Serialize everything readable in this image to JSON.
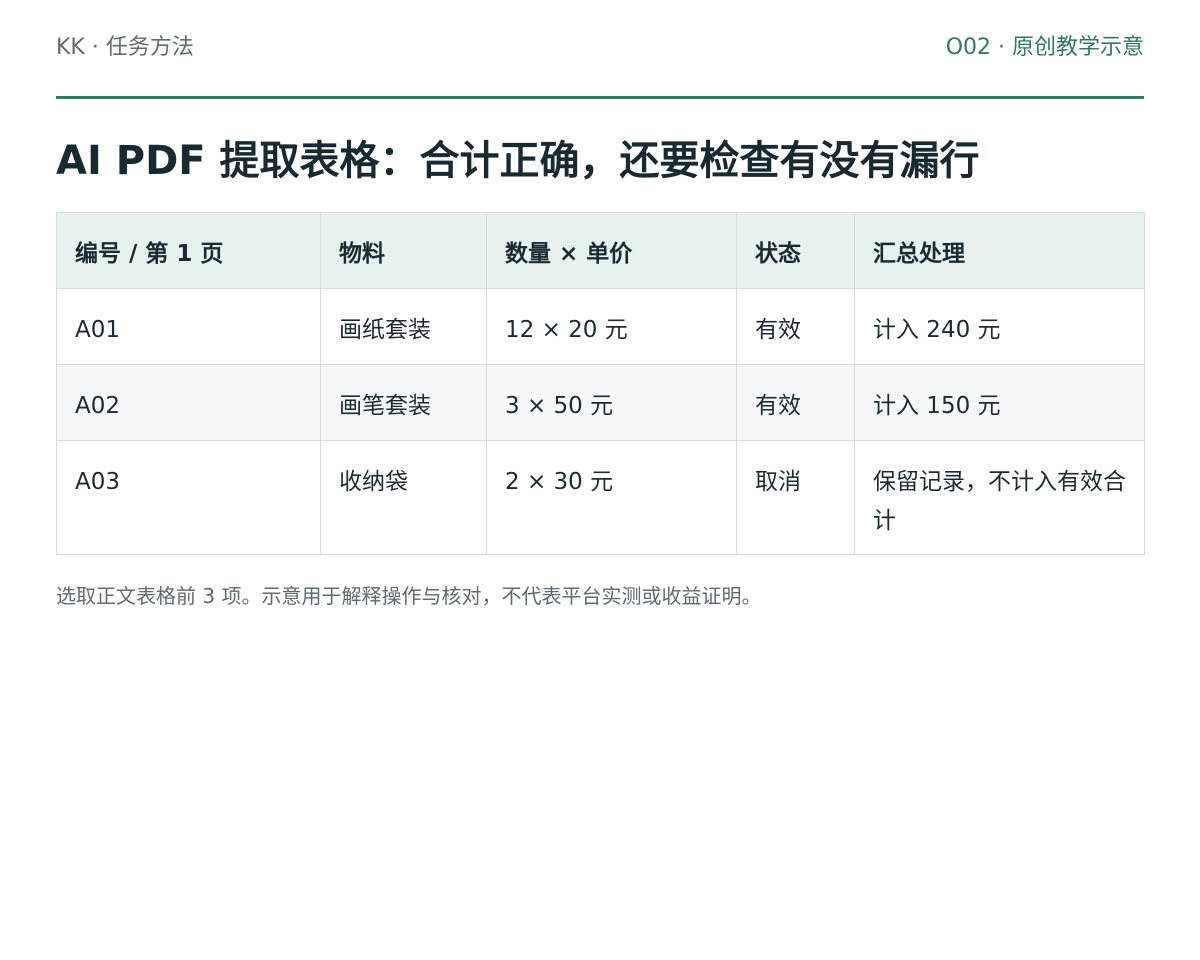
{
  "header": {
    "left": "KK · 任务方法",
    "right": "O02 · 原创教学示意"
  },
  "title": "AI PDF 提取表格：合计正确，还要检查有没有漏行",
  "table": {
    "columns": [
      "编号 / 第 1 页",
      "物料",
      "数量 × 单价",
      "状态",
      "汇总处理"
    ],
    "rows": [
      [
        "A01",
        "画纸套装",
        "12 × 20 元",
        "有效",
        "计入 240 元"
      ],
      [
        "A02",
        "画笔套装",
        "3 × 50 元",
        "有效",
        "计入 150 元"
      ],
      [
        "A03",
        "收纳袋",
        "2 × 30 元",
        "取消",
        "保留记录，不计入有效合计"
      ]
    ]
  },
  "footnote": "选取正文表格前 3 项。示意用于解释操作与核对，不代表平台实测或收益证明。"
}
